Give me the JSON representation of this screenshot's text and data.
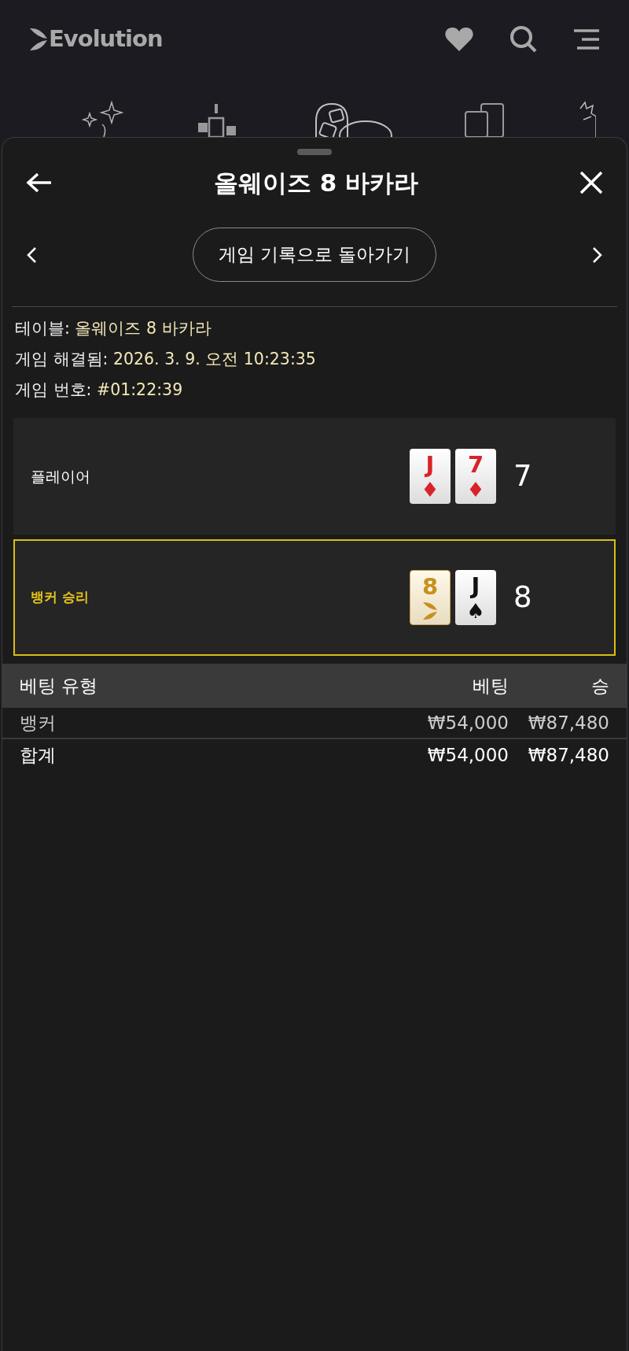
{
  "brand": {
    "name": "Evolution"
  },
  "sheet": {
    "title": "올웨이즈 8 바카라",
    "back_link": "게임 기록으로 돌아가기"
  },
  "info": [
    {
      "label": "테이블:",
      "value": "올웨이즈 8 바카라"
    },
    {
      "label": "게임 해결됨:",
      "value": "2026. 3. 9. 오전 10:23:35"
    },
    {
      "label": "게임 번호:",
      "value": "#01:22:39"
    }
  ],
  "hands": [
    {
      "name": "플레이어",
      "winner": false,
      "score": "7",
      "cards": [
        {
          "rank": "J",
          "suit": "♦",
          "kind": "red"
        },
        {
          "rank": "7",
          "suit": "♦",
          "kind": "red"
        }
      ]
    },
    {
      "name": "뱅커 승리",
      "winner": true,
      "score": "8",
      "cards": [
        {
          "rank": "8",
          "kind": "bonus"
        },
        {
          "rank": "J",
          "suit": "♠",
          "kind": "black"
        }
      ]
    }
  ],
  "bets": {
    "columns": [
      "베팅 유형",
      "베팅",
      "승"
    ],
    "rows": [
      [
        "뱅커",
        "₩54,000",
        "₩87,480"
      ]
    ],
    "total": [
      "합계",
      "₩54,000",
      "₩87,480"
    ]
  }
}
